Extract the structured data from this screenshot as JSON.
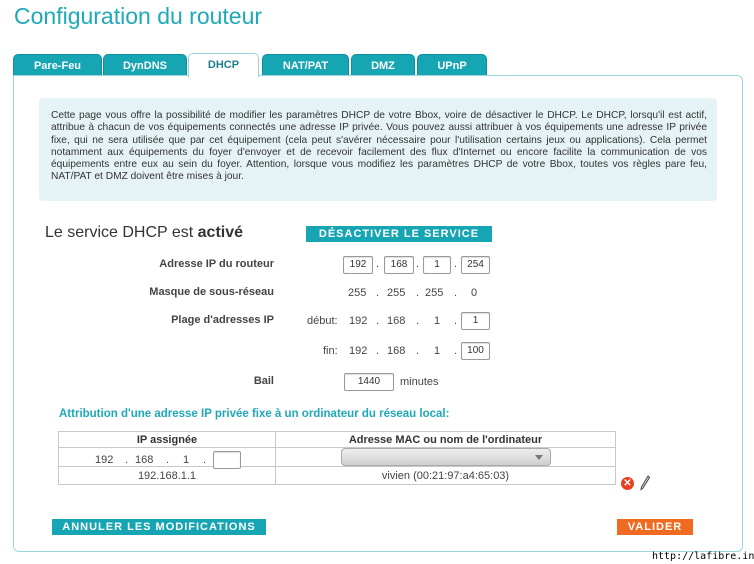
{
  "header": {
    "title": "Configuration du routeur"
  },
  "tabs": [
    {
      "label": "Pare-Feu",
      "active": false
    },
    {
      "label": "DynDNS",
      "active": false
    },
    {
      "label": "DHCP",
      "active": true
    },
    {
      "label": "NAT/PAT",
      "active": false
    },
    {
      "label": "DMZ",
      "active": false
    },
    {
      "label": "UPnP",
      "active": false
    }
  ],
  "info": {
    "text": "Cette page vous offre la possibilité de modifier les paramètres DHCP de votre Bbox, voire de désactiver le DHCP. Le DHCP, lorsqu'il est actif, attribue à chacun de vos équipements connectés une adresse IP privée. Vous pouvez aussi attribuer à vos équipements une adresse IP privée fixe, qui ne sera utilisée que par cet équipement (cela peut s'avérer nécessaire pour l'utilisation certains jeux ou applications). Cela permet notamment aux équipements du foyer d'envoyer et de recevoir facilement des flux d'Internet ou encore facilite la communication de vos équipements entre eux au sein du foyer. Attention, lorsque vous modifiez les paramètres DHCP de votre Bbox, toutes vos règles pare feu, NAT/PAT et DMZ doivent être mises à jour."
  },
  "service": {
    "status_prefix": "Le service DHCP est",
    "status_value": "activé",
    "disable_button": "DÉSACTIVER LE SERVICE"
  },
  "form": {
    "router_ip_label": "Adresse IP du routeur",
    "router_ip": [
      "192",
      "168",
      "1",
      "254"
    ],
    "mask_label": "Masque de sous-réseau",
    "mask": [
      "255",
      "255",
      "255",
      "0"
    ],
    "range_label": "Plage d'adresses IP",
    "start_label": "début:",
    "start": [
      "192",
      "168",
      "1",
      "1"
    ],
    "end_label": "fin:",
    "end": [
      "192",
      "168",
      "1",
      "100"
    ],
    "lease_label": "Bail",
    "lease_value": "1440",
    "lease_unit": "minutes"
  },
  "assignment": {
    "title": "Attribution d'une adresse IP privée fixe à un ordinateur du réseau local:",
    "col_ip": "IP assignée",
    "col_mac": "Adresse MAC ou nom de l'ordinateur",
    "new_ip": [
      "192",
      "168",
      "1",
      ""
    ],
    "new_select_value": "",
    "rows": [
      {
        "ip": "192.168.1.1",
        "mac": "vivien (00:21:97:a4:65:03)"
      }
    ]
  },
  "footer": {
    "cancel_button": "ANNULER LES MODIFICATIONS",
    "submit_button": "VALIDER",
    "watermark": "http://lafibre.info"
  },
  "colors": {
    "accent": "#16a5b3",
    "title": "#1ea9b8",
    "action": "#ee6b21",
    "info_bg": "#e6f3f6"
  },
  "icons": [
    "delete-icon",
    "edit-pencil-icon",
    "chevron-down-icon"
  ]
}
